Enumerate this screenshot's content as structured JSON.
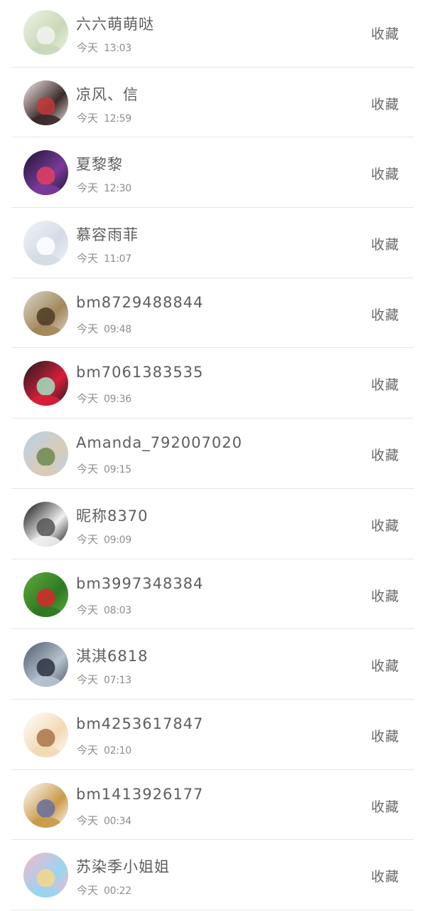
{
  "items": [
    {
      "name": "六六萌萌哒",
      "day": "今天",
      "time": "13:03",
      "action": "收藏",
      "avatar": "avatar-bunny-icon",
      "colors": [
        "#eef3e6",
        "#c9d8b8",
        "#f2f2ee"
      ]
    },
    {
      "name": "凉风、信",
      "day": "今天",
      "time": "12:59",
      "action": "收藏",
      "avatar": "avatar-woman-portrait-icon",
      "colors": [
        "#f7eaea",
        "#3a2a2a",
        "#c23a3a"
      ]
    },
    {
      "name": "夏黎黎",
      "day": "今天",
      "time": "12:30",
      "action": "收藏",
      "avatar": "avatar-neon-girl-icon",
      "colors": [
        "#1d1530",
        "#7a3a9a",
        "#e04060"
      ]
    },
    {
      "name": "慕容雨菲",
      "day": "今天",
      "time": "11:07",
      "action": "收藏",
      "avatar": "avatar-white-dress-icon",
      "colors": [
        "#f2f4f8",
        "#d4dbe6",
        "#ffffff"
      ]
    },
    {
      "name": "bm8729488844",
      "day": "今天",
      "time": "09:48",
      "action": "收藏",
      "avatar": "avatar-sunset-landscape-icon",
      "colors": [
        "#d9d6c8",
        "#a3875a",
        "#4d3b22"
      ]
    },
    {
      "name": "bm7061383535",
      "day": "今天",
      "time": "09:36",
      "action": "收藏",
      "avatar": "avatar-red-heart-icon",
      "colors": [
        "#1b1b1f",
        "#d81e3a",
        "#9fe0c0"
      ]
    },
    {
      "name": "Amanda_792007020",
      "day": "今天",
      "time": "09:15",
      "action": "收藏",
      "avatar": "avatar-castle-icon",
      "colors": [
        "#b8d3ea",
        "#d8cbb8",
        "#6c8a4c"
      ]
    },
    {
      "name": "昵称8370",
      "day": "今天",
      "time": "09:09",
      "action": "收藏",
      "avatar": "avatar-exo-group-icon",
      "colors": [
        "#111111",
        "#f0f0f0",
        "#555555"
      ]
    },
    {
      "name": "bm3997348384",
      "day": "今天",
      "time": "08:03",
      "action": "收藏",
      "avatar": "avatar-red-car-icon",
      "colors": [
        "#5eab3e",
        "#2f7a22",
        "#d9272e"
      ]
    },
    {
      "name": "淇淇6818",
      "day": "今天",
      "time": "07:13",
      "action": "收藏",
      "avatar": "avatar-mountain-clouds-icon",
      "colors": [
        "#4e5a6c",
        "#b7c2cf",
        "#2c3340"
      ]
    },
    {
      "name": "bm4253617847",
      "day": "今天",
      "time": "02:10",
      "action": "收藏",
      "avatar": "avatar-cartoon-boy-icon",
      "colors": [
        "#ffffff",
        "#f3d9b4",
        "#a9744a"
      ]
    },
    {
      "name": "bm1413926177",
      "day": "今天",
      "time": "00:34",
      "action": "收藏",
      "avatar": "avatar-totoro-icon",
      "colors": [
        "#ffffff",
        "#c99a4a",
        "#6a6fa0"
      ]
    },
    {
      "name": "苏染季小姐姐",
      "day": "今天",
      "time": "00:22",
      "action": "收藏",
      "avatar": "avatar-rainbow-girl-icon",
      "colors": [
        "#f5b8c8",
        "#9ad4f0",
        "#f7d68a"
      ]
    }
  ]
}
